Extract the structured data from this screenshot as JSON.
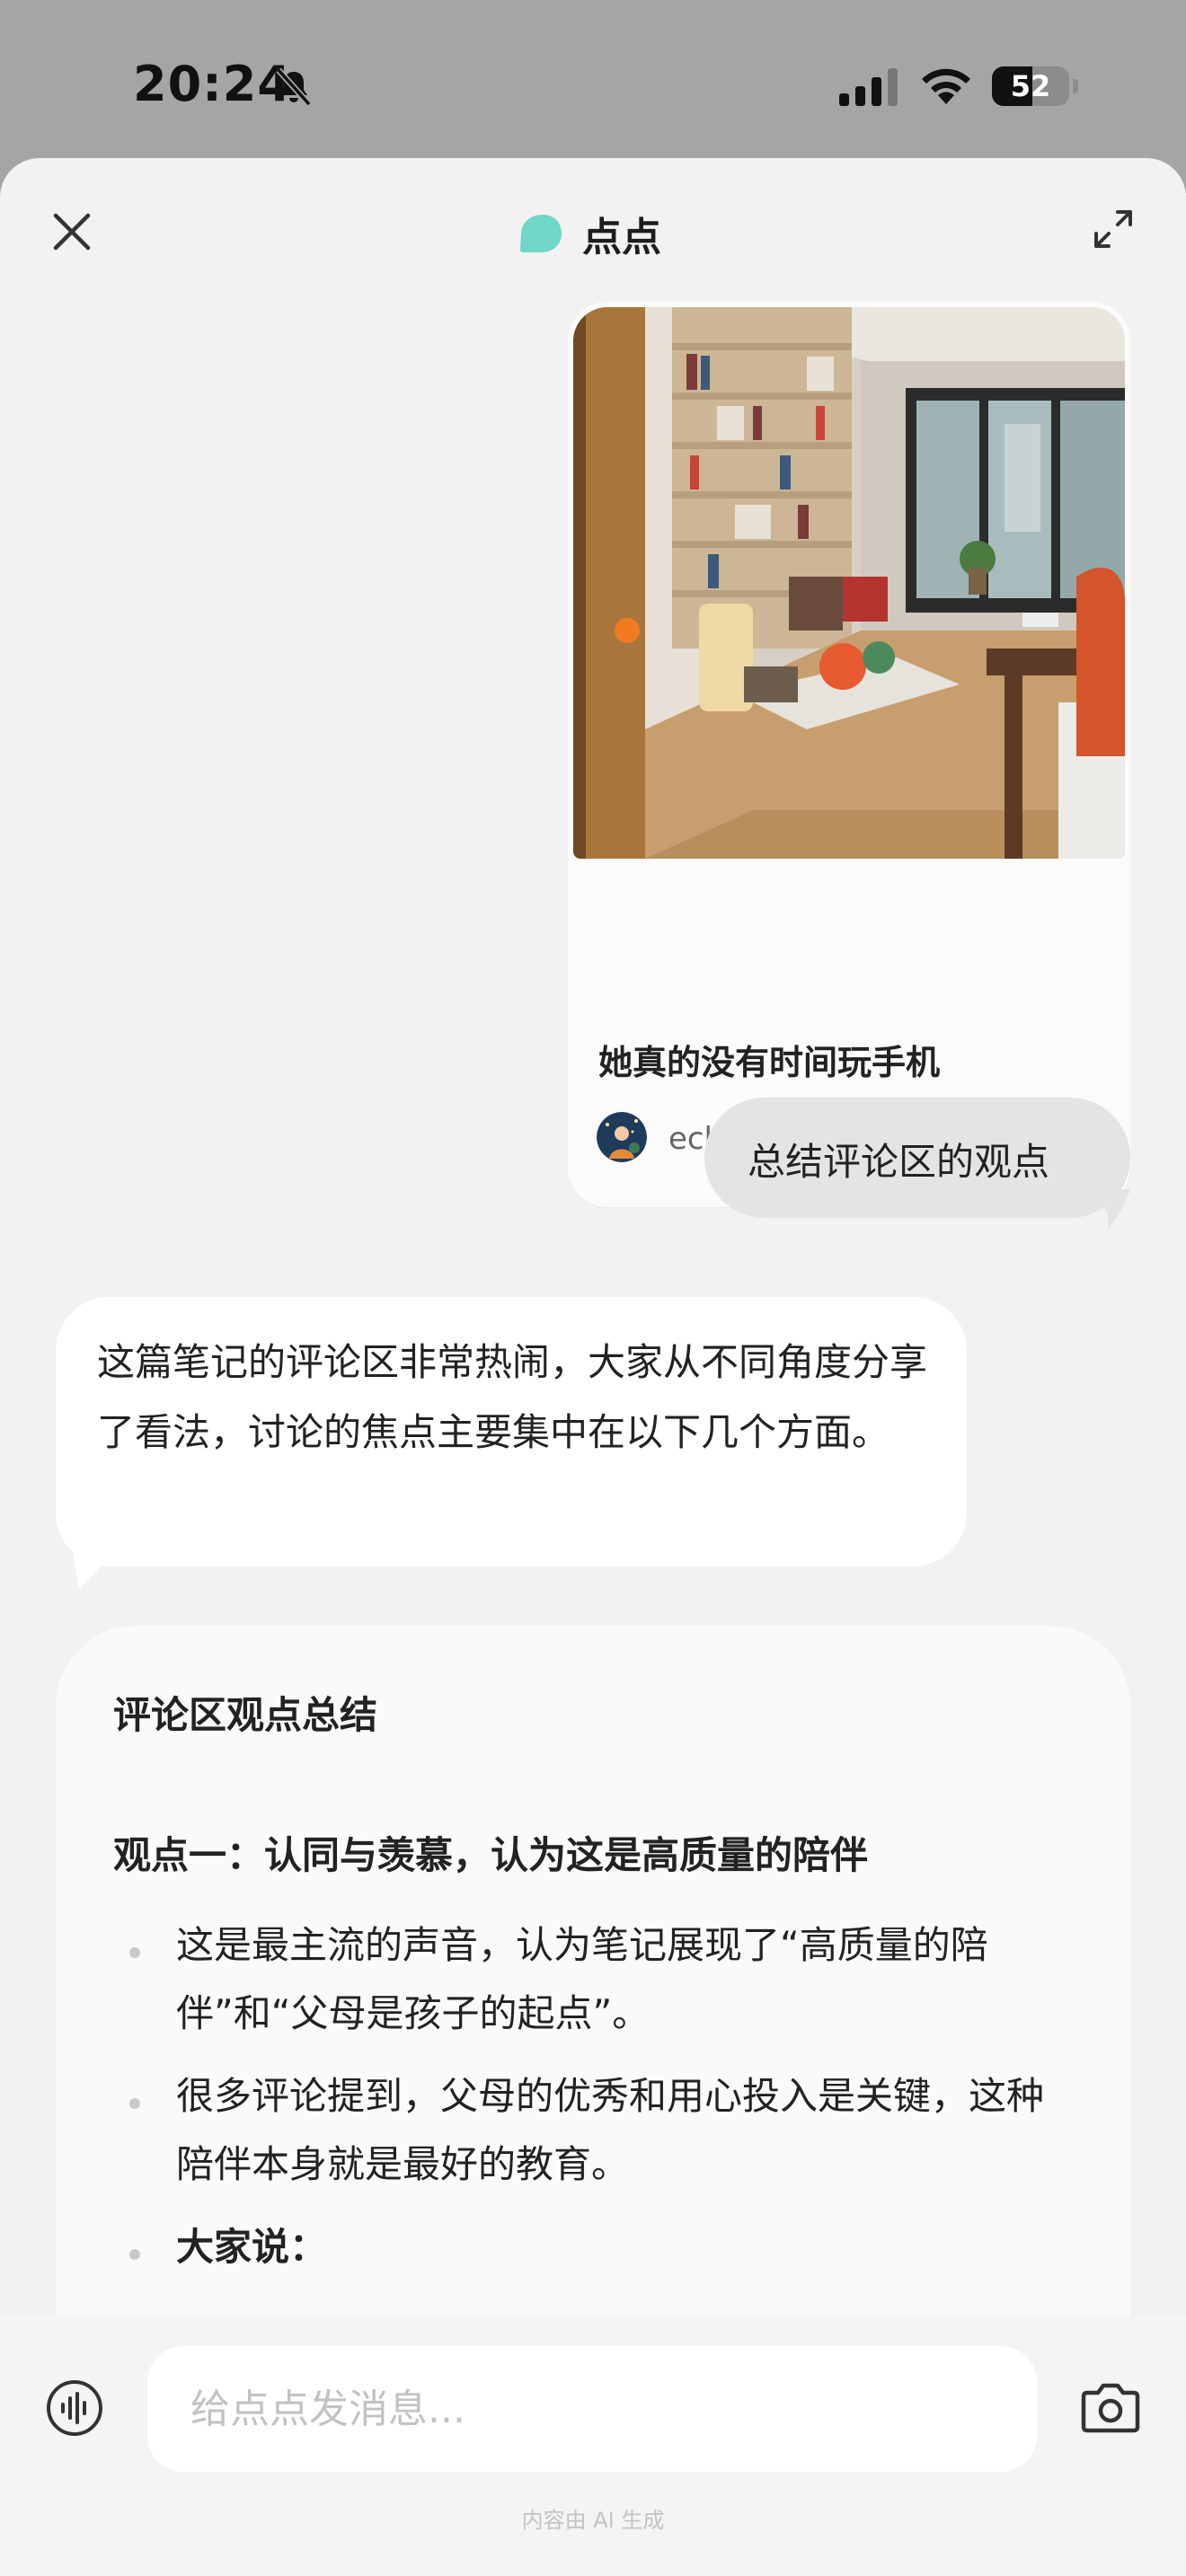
{
  "status_bar": {
    "time": "20:24",
    "battery_percent": "52",
    "battery_level": 0.52
  },
  "header": {
    "title": "点点",
    "brand_color": "#6fd6c8"
  },
  "note_card": {
    "title": "她真的没有时间玩手机",
    "author": "echo"
  },
  "user_message": "总结评论区的观点",
  "ai_message": "这篇笔记的评论区非常热闹，大家从不同角度分享了看法，讨论的焦点主要集中在以下几个方面。",
  "summary": {
    "title": "评论区观点总结",
    "viewpoint_1": {
      "title": "观点一：认同与羡慕，认为这是高质量的陪伴",
      "bullets": [
        "这是最主流的声音，认为笔记展现了“高质量的陪伴”和“父母是孩子的起点”。",
        "很多评论提到，父母的优秀和用心投入是关键，这种陪伴本身就是最好的教育。",
        "大家说："
      ]
    }
  },
  "input": {
    "placeholder": "给点点发消息...",
    "value": ""
  },
  "disclaimer": "内容由 AI 生成",
  "icons": {
    "close": "close-icon",
    "expand": "expand-icon",
    "voice": "voice-wave-icon",
    "camera": "camera-icon",
    "mute": "bell-slash-icon",
    "signal": "cellular-signal-icon",
    "wifi": "wifi-icon",
    "battery": "battery-icon"
  }
}
